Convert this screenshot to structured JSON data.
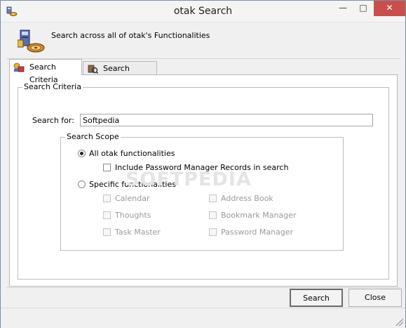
{
  "window": {
    "title": "otak Search"
  },
  "header": {
    "text": "Search across all of otak's Functionalities"
  },
  "tabs": [
    {
      "label": "Search Criteria",
      "active": true
    },
    {
      "label": "Search Results",
      "active": false
    }
  ],
  "criteria": {
    "legend": "Search Criteria",
    "search_label": "Search for:",
    "search_value": "Softpedia"
  },
  "scope": {
    "legend": "Search Scope",
    "all_label": "All otak functionalities",
    "include_pm_label": "Include Password Manager Records in search",
    "specific_label": "Specific functionalities",
    "items": [
      {
        "label": "Calendar"
      },
      {
        "label": "Address Book"
      },
      {
        "label": "Thoughts"
      },
      {
        "label": "Bookmark Manager"
      },
      {
        "label": "Task Master"
      },
      {
        "label": "Password Manager"
      }
    ]
  },
  "watermark": "SOFTPEDIA",
  "buttons": {
    "search": "Search",
    "close": "Close"
  },
  "colors": {
    "close_button": "#c7504c",
    "panel_bg": "#ffffff",
    "window_bg": "#f0f0f0"
  }
}
